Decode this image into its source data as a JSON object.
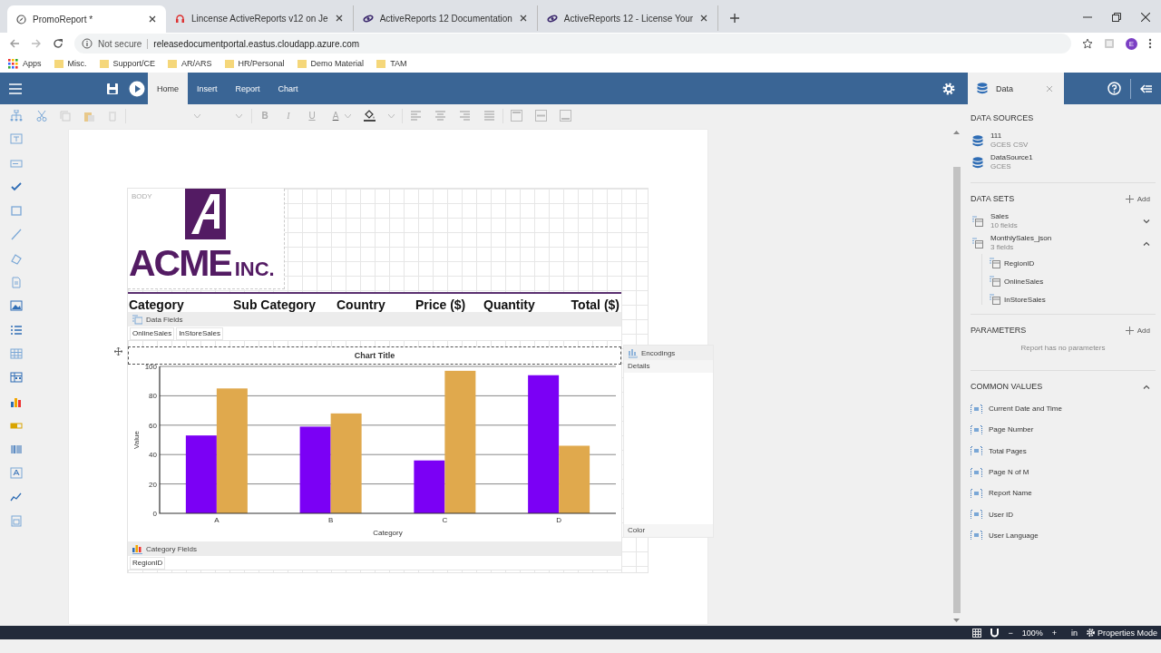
{
  "browser": {
    "tabs": [
      {
        "title": "PromoReport *",
        "kind": "app",
        "selected": true
      },
      {
        "title": "Lincense ActiveReports v12 on Je",
        "kind": "support",
        "selected": false
      },
      {
        "title": "ActiveReports 12 Documentation",
        "kind": "product",
        "selected": false
      },
      {
        "title": "ActiveReports 12 - License Your",
        "kind": "product",
        "selected": false
      }
    ],
    "address": {
      "security": "Not secure",
      "url": "releasedocumentportal.eastus.cloudapp.azure.com"
    },
    "profile": "E",
    "bookmarks": [
      {
        "label": "Apps",
        "kind": "apps"
      },
      {
        "label": "Misc.",
        "kind": "folder"
      },
      {
        "label": "Support/CE",
        "kind": "folder"
      },
      {
        "label": "AR/ARS",
        "kind": "folder"
      },
      {
        "label": "HR/Personal",
        "kind": "folder"
      },
      {
        "label": "Demo Material",
        "kind": "folder"
      },
      {
        "label": "TAM",
        "kind": "folder"
      }
    ]
  },
  "app": {
    "tabs": [
      {
        "label": "Home",
        "selected": true
      },
      {
        "label": "Insert",
        "selected": false
      },
      {
        "label": "Report",
        "selected": false
      },
      {
        "label": "Chart",
        "selected": false
      }
    ],
    "panel_tab": {
      "label": "Data",
      "selected": true
    }
  },
  "toolbar": {
    "format_buttons": [
      "B",
      "I",
      "U"
    ],
    "font_color": "A"
  },
  "report": {
    "body_label": "BODY",
    "logo": {
      "name": "ACME",
      "suffix": "INC."
    },
    "headers": [
      "Category",
      "Sub Category",
      "Country",
      "Price ($)",
      "Quantity",
      "Total ($)"
    ],
    "data_fields": {
      "title": "Data Fields",
      "fields": [
        "OnlineSales",
        "InStoreSales"
      ]
    },
    "chart": {
      "chart_data": {
        "type": "bar",
        "title": "Chart Title",
        "xlabel": "Category",
        "ylabel": "Value",
        "categories": [
          "A",
          "B",
          "C",
          "D"
        ],
        "series": [
          {
            "color": "#7b00f5",
            "values": [
              53,
              59,
              36,
              94
            ]
          },
          {
            "color": "#e0a94d",
            "values": [
              85,
              68,
              97,
              46
            ]
          }
        ],
        "ylim": [
          0,
          100
        ],
        "yticks": [
          0,
          20,
          40,
          60,
          80,
          100
        ],
        "grid": true
      }
    },
    "encodings": {
      "title": "Encodings",
      "slots": [
        "Details",
        "Color"
      ]
    },
    "category_fields": {
      "title": "Category Fields",
      "fields": [
        "RegionID"
      ]
    }
  },
  "data_panel": {
    "data_sources": {
      "title": "DATA SOURCES",
      "items": [
        {
          "name": "111",
          "type": "GCES CSV"
        },
        {
          "name": "DataSource1",
          "type": "GCES"
        }
      ]
    },
    "data_sets": {
      "title": "DATA SETS",
      "add": "Add",
      "items": [
        {
          "name": "Sales",
          "count": "10 fields",
          "expanded": false
        },
        {
          "name": "MonthlySales_json",
          "count": "3 fields",
          "expanded": true,
          "children": [
            {
              "name": "RegionID"
            },
            {
              "name": "OnlineSales"
            },
            {
              "name": "InStoreSales"
            }
          ]
        }
      ]
    },
    "parameters": {
      "title": "PARAMETERS",
      "add": "Add",
      "empty": "Report has no parameters"
    },
    "common_values": {
      "title": "COMMON VALUES",
      "expanded": true,
      "items": [
        "Current Date and Time",
        "Page Number",
        "Total Pages",
        "Page N of M",
        "Report Name",
        "User ID",
        "User Language"
      ]
    }
  },
  "status_bar": {
    "zoom_out": "−",
    "zoom": "100%",
    "zoom_in": "+",
    "units": "in",
    "mode": "Properties Mode"
  }
}
